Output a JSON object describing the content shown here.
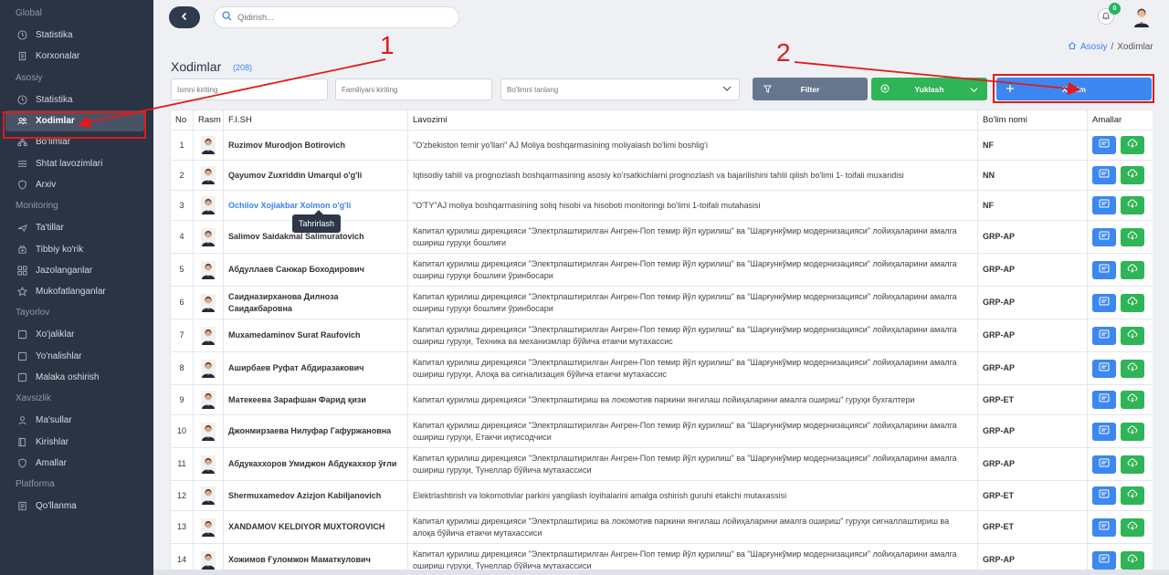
{
  "sidebar": {
    "sections": [
      {
        "title": "Global",
        "items": [
          {
            "label": "Statistika",
            "icon": "clock-icon"
          },
          {
            "label": "Korxonalar",
            "icon": "building-icon"
          }
        ]
      },
      {
        "title": "Asosiy",
        "items": [
          {
            "label": "Statistika",
            "icon": "clock-icon"
          },
          {
            "label": "Xodimlar",
            "icon": "users-icon",
            "active": true
          },
          {
            "label": "Bo'limlar",
            "icon": "sitemap-icon"
          },
          {
            "label": "Shtat lavozimlari",
            "icon": "list-icon"
          },
          {
            "label": "Arxiv",
            "icon": "shield-icon"
          }
        ]
      },
      {
        "title": "Monitoring",
        "items": [
          {
            "label": "Ta'tillar",
            "icon": "plane-icon"
          },
          {
            "label": "Tibbiy ko'rik",
            "icon": "medical-icon"
          },
          {
            "label": "Jazolanganlar",
            "icon": "grid-icon"
          },
          {
            "label": "Mukofatlanganlar",
            "icon": "star-icon"
          }
        ]
      },
      {
        "title": "Tayorlov",
        "items": [
          {
            "label": "Xo'jaliklar",
            "icon": "square-icon"
          },
          {
            "label": "Yo'nalishlar",
            "icon": "square-icon"
          },
          {
            "label": "Malaka oshirish",
            "icon": "square-icon"
          }
        ]
      },
      {
        "title": "Xavsizlik",
        "items": [
          {
            "label": "Ma'sullar",
            "icon": "user-icon"
          },
          {
            "label": "Kirishlar",
            "icon": "book-icon"
          },
          {
            "label": "Amallar",
            "icon": "shield-icon"
          }
        ]
      },
      {
        "title": "Platforma",
        "items": [
          {
            "label": "Qo'llanma",
            "icon": "document-icon"
          }
        ]
      }
    ]
  },
  "topbar": {
    "search_placeholder": "Qidirish...",
    "notification_count": "0"
  },
  "breadcrumb": {
    "home": "Asosiy",
    "separator": "/",
    "current": "Xodimlar"
  },
  "page": {
    "title": "Xodimlar",
    "count": "(208)"
  },
  "filters": {
    "first_name_placeholder": "Ismni kiriting",
    "last_name_placeholder": "Familiyani kiriting",
    "department_placeholder": "Bo'limni tanlang",
    "filter_label": "Filter",
    "upload_label": "Yuklash",
    "add_label": "Xodim"
  },
  "table": {
    "columns": [
      "No",
      "Rasm",
      "F.I.SH",
      "Lavozimi",
      "Bo'lim nomi",
      "Amallar"
    ],
    "rows": [
      {
        "no": "1",
        "name": "Ruzimov Murodjon Botirovich",
        "position": "\"O'zbekiston temir yo'llari\" AJ Moliya boshqarmasining moliyalash bo'limi boshlig'i",
        "dept": "NF"
      },
      {
        "no": "2",
        "name": "Qayumov Zuxriddin Umarqul o'g'li",
        "position": "Iqtisodiy tahlil va prognozlash boshqarmasining asosiy ko'rsatkichlarni prognozlash va bajarilishini tahlil qilish bo'limi 1- toifali muxandisi",
        "dept": "NN"
      },
      {
        "no": "3",
        "name": "Ochilov Xojiakbar Xolmon o'g'li",
        "position": "\"O'TY\"AJ moliya boshqarmasining soliq hisobi va hisoboti monitoringi bo'limi 1-toifali mutahasisi",
        "dept": "NF",
        "link": true
      },
      {
        "no": "4",
        "name": "Salimov Saidakmal Salimuratovich",
        "position": "Капитал қурилиш дирекцияси \"Электрлаштирилган Ангрен-Поп темир йўл қурилиш\" ва \"Шарғункўмир модернизацияси\" лойиҳаларини амалга ошириш гуруҳи бошлиғи",
        "dept": "GRP-AP"
      },
      {
        "no": "5",
        "name": "Абдуллаев Санжар Боходирович",
        "position": "Капитал қурилиш дирекцияси \"Электрлаштирилган Ангрен-Поп темир йўл қурилиш\" ва \"Шарғункўмир модернизацияси\" лойиҳаларини амалга ошириш гуруҳи бошлиғи ўринбосари",
        "dept": "GRP-AP"
      },
      {
        "no": "6",
        "name": "Саидназирханова Дилноза Саидакбаровна",
        "position": "Капитал қурилиш дирекцияси \"Электрлаштирилган Ангрен-Поп темир йўл қурилиш\" ва \"Шарғункўмир модернизацияси\" лойиҳаларини амалга ошириш гуруҳи бошлиғи ўринбосари",
        "dept": "GRP-AP"
      },
      {
        "no": "7",
        "name": "Muxamedaminov Surat Raufovich",
        "position": "Капитал қурилиш дирекцияси \"Электрлаштирилган Ангрен-Поп темир йўл қурилиш\" ва \"Шарғункўмир модернизацияси\" лойиҳаларини амалга ошириш гуруҳи, Техника ва механизмлар бўйича етакчи мутахассис",
        "dept": "GRP-AP"
      },
      {
        "no": "8",
        "name": "Аширбаев Руфат Абдиразакович",
        "position": "Капитал қурилиш дирекцияси \"Электрлаштирилган Ангрен-Поп темир йўл қурилиш\" ва \"Шарғункўмир модернизацияси\" лойиҳаларини амалга ошириш гуруҳи, Алоқа ва сигнализация бўйича етакчи мутахассис",
        "dept": "GRP-AP"
      },
      {
        "no": "9",
        "name": "Матекеева Зарафшан Фарид қизи",
        "position": "Капитал қурилиш дирекцияси \"Электрлаштириш ва локомотив паркини янгилаш лойиҳаларини амалга ошириш\" гуруҳи бухгалтери",
        "dept": "GRP-ET"
      },
      {
        "no": "10",
        "name": "Джонмирзаева Нилуфар Гафуржановна",
        "position": "Капитал қурилиш дирекцияси \"Электрлаштирилган Ангрен-Поп темир йўл қурилиш\" ва \"Шарғункўмир модернизацияси\" лойиҳаларини амалга ошириш гуруҳи, Етакчи иқтисодчиси",
        "dept": "GRP-AP"
      },
      {
        "no": "11",
        "name": "Абдукаххоров Умиджон Абдукаххор ўғли",
        "position": "Капитал қурилиш дирекцияси \"Электрлаштирилган Ангрен-Поп темир йўл қурилиш\" ва \"Шарғункўмир модернизацияси\" лойиҳаларини амалга ошириш гуруҳи, Тунеллар бўйича мутахассиси",
        "dept": "GRP-AP"
      },
      {
        "no": "12",
        "name": "Shermuxamedov Azizjon Kabiljanovich",
        "position": "Elektrlashtirish va lokomotivlar parkini yangilash loyihalarini amalga oshirish guruhi etakchi mutaxassisi",
        "dept": "GRP-ET"
      },
      {
        "no": "13",
        "name": "XANDAMOV KELDIYOR MUXTOROVICH",
        "position": "Капитал қурилиш дирекцияси \"Электрлаштириш ва локомотив паркини янгилаш лойиҳаларини амалга ошириш\" гуруҳи сигналлаштириш ва алоқа бўйича етакчи мутахассиси",
        "dept": "GRP-ET"
      },
      {
        "no": "14",
        "name": "Хожимов Ғуломжон Маматкулович",
        "position": "Капитал қурилиш дирекцияси \"Электрлаштирилган Ангрен-Поп темир йўл қурилиш\" ва \"Шарғункўмир модернизацияси\" лойиҳаларини амалга ошириш гуруҳи, Тунеллар бўйича мутахассиси",
        "dept": "GRP-AP"
      }
    ]
  },
  "tooltip": "Tahrirlash",
  "annotations": {
    "marker_1": "1",
    "marker_2": "2"
  },
  "colors": {
    "sidebar_bg": "#2b3444",
    "primary": "#3d87f0",
    "success": "#2fb457",
    "secondary": "#66778d",
    "annotation": "#e01b1b"
  }
}
